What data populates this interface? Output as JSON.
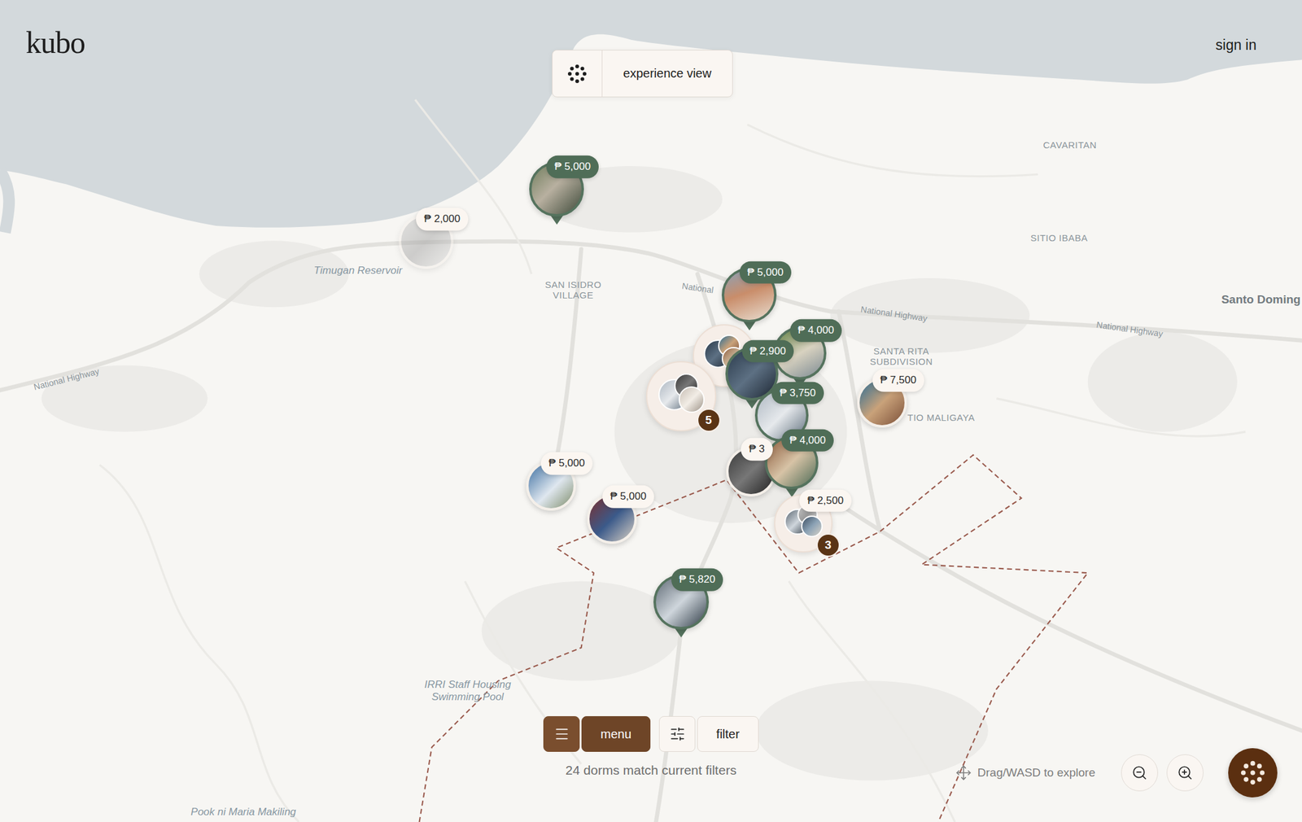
{
  "app": {
    "logo": "kubo",
    "sign_in": "sign in"
  },
  "view_toggle": {
    "label": "experience view"
  },
  "controls": {
    "menu": "menu",
    "filter": "filter",
    "match_count": "24 dorms match current filters"
  },
  "navigation": {
    "hint": "Drag/WASD to explore"
  },
  "pins": [
    {
      "kind": "listing",
      "price": "₱ 5,000",
      "featured": true,
      "dimmed": false
    },
    {
      "kind": "listing",
      "price": "₱ 2,000",
      "featured": false,
      "dimmed": true
    },
    {
      "kind": "listing",
      "price": "₱ 5,000",
      "featured": true,
      "dimmed": false
    },
    {
      "kind": "cluster",
      "count": "",
      "featured": false,
      "dimmed": false
    },
    {
      "kind": "cluster",
      "count": "5",
      "featured": false,
      "dimmed": false
    },
    {
      "kind": "listing",
      "price": "₱ 4,000",
      "featured": true,
      "dimmed": false
    },
    {
      "kind": "listing",
      "price": "₱ 2,900",
      "featured": true,
      "dimmed": false
    },
    {
      "kind": "listing",
      "price": "₱ 3,750",
      "featured": true,
      "dimmed": false
    },
    {
      "kind": "listing",
      "price": "₱ 7,500",
      "featured": false,
      "dimmed": false
    },
    {
      "kind": "listing",
      "price": "₱ 3",
      "featured": false,
      "dimmed": false
    },
    {
      "kind": "listing",
      "price": "₱ 4,000",
      "featured": true,
      "dimmed": false
    },
    {
      "kind": "cluster",
      "count": "3",
      "price": "₱ 2,500",
      "featured": false,
      "dimmed": false
    },
    {
      "kind": "listing",
      "price": "₱ 5,000",
      "featured": false,
      "dimmed": false
    },
    {
      "kind": "listing",
      "price": "₱ 5,000",
      "featured": false,
      "dimmed": false
    },
    {
      "kind": "listing",
      "price": "₱ 5,820",
      "featured": true,
      "dimmed": false
    }
  ],
  "map_labels": [
    {
      "text": "CAVARITAN",
      "kind": "area"
    },
    {
      "text": "SITIO IBABA",
      "kind": "area"
    },
    {
      "text": "Santo Doming",
      "kind": "town"
    },
    {
      "text": "SAN ISIDRO VILLAGE",
      "kind": "area"
    },
    {
      "text": "SANTA RITA SUBDIVISION",
      "kind": "area"
    },
    {
      "text": "TIO MALIGAYA",
      "kind": "area"
    },
    {
      "text": "Timugan Reservoir",
      "kind": "poi"
    },
    {
      "text": "IRRI Staff Housing Swimming Pool",
      "kind": "poi"
    },
    {
      "text": "Pook ni Maria Makiling",
      "kind": "poi"
    },
    {
      "text": "National Highway",
      "kind": "road"
    },
    {
      "text": "National Highway",
      "kind": "road"
    },
    {
      "text": "National Highway",
      "kind": "road"
    },
    {
      "text": "National",
      "kind": "road"
    }
  ]
}
